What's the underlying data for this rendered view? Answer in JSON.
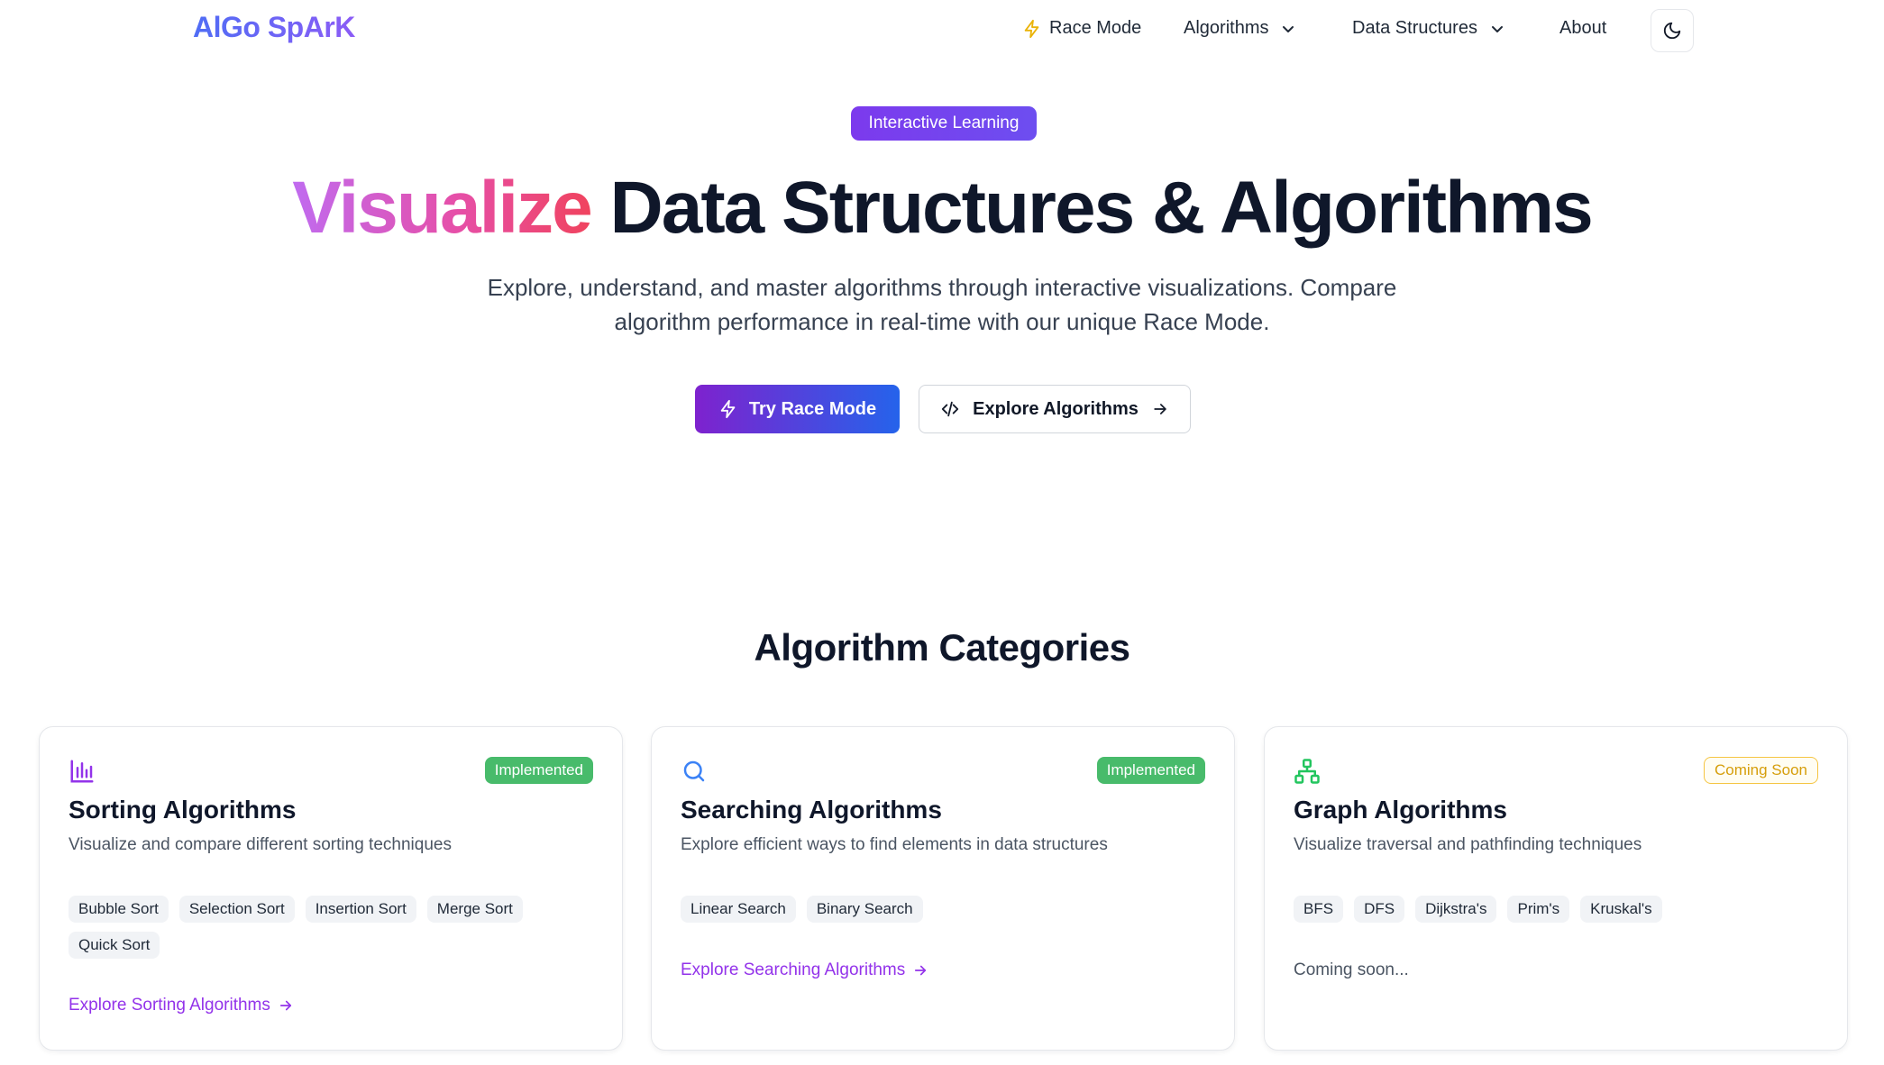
{
  "nav": {
    "logo": "AlGo SpArK",
    "race_mode": "Race Mode",
    "algorithms": "Algorithms",
    "data_structures": "Data Structures",
    "about": "About"
  },
  "hero": {
    "badge": "Interactive Learning",
    "title_highlight": "Visualize",
    "title_rest": " Data Structures & Algorithms",
    "subtitle": "Explore, understand, and master algorithms through interactive visualizations. Compare algorithm performance in real-time with our unique Race Mode.",
    "primary_button": "Try Race Mode",
    "secondary_button": "Explore Algorithms"
  },
  "categories": {
    "title": "Algorithm Categories",
    "cards": [
      {
        "icon": "bar-chart-icon",
        "status": "Implemented",
        "title": "Sorting Algorithms",
        "description": "Visualize and compare different sorting techniques",
        "tags": [
          "Bubble Sort",
          "Selection Sort",
          "Insertion Sort",
          "Merge Sort",
          "Quick Sort"
        ],
        "link": "Explore Sorting Algorithms"
      },
      {
        "icon": "search-icon",
        "status": "Implemented",
        "title": "Searching Algorithms",
        "description": "Explore efficient ways to find elements in data structures",
        "tags": [
          "Linear Search",
          "Binary Search"
        ],
        "link": "Explore Searching Algorithms"
      },
      {
        "icon": "network-icon",
        "status": "Coming Soon",
        "title": "Graph Algorithms",
        "description": "Visualize traversal and pathfinding techniques",
        "tags": [
          "BFS",
          "DFS",
          "Dijkstra's",
          "Prim's",
          "Kruskal's"
        ],
        "footer": "Coming soon..."
      }
    ]
  },
  "colors": {
    "accent_purple": "#7c3aed",
    "accent_blue": "#2563eb",
    "implemented_green": "#48bb6b",
    "coming_soon_amber": "#f5c542",
    "link_purple": "#9333ea"
  }
}
